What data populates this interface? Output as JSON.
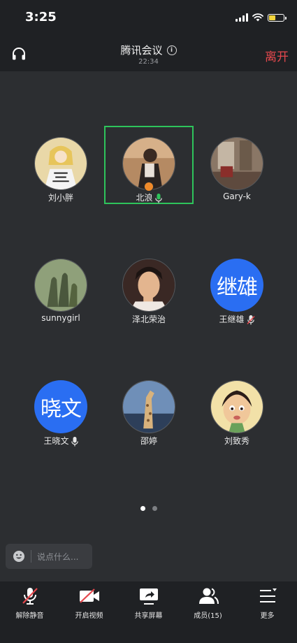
{
  "status_bar": {
    "time": "3:25"
  },
  "header": {
    "title": "腾讯会议",
    "duration": "22:34",
    "leave_label": "离开"
  },
  "participants": [
    {
      "name": "刘小胖",
      "avatar": "photo-girl-sailor"
    },
    {
      "name": "北浪",
      "avatar": "photo-man-coat",
      "speaking": true,
      "mic": "on",
      "host": true
    },
    {
      "name": "Gary-k",
      "avatar": "photo-room"
    },
    {
      "name": "sunnygirl",
      "avatar": "photo-shadows"
    },
    {
      "name": "泽北荣治",
      "avatar": "photo-man-thinking"
    },
    {
      "name": "王继雄",
      "avatar_text": "继雄",
      "mic": "muted"
    },
    {
      "name": "王晓文",
      "avatar_text": "晓文",
      "mic": "on"
    },
    {
      "name": "邵婷",
      "avatar": "photo-giraffe"
    },
    {
      "name": "刘致秀",
      "avatar": "photo-cartoon-girl"
    }
  ],
  "pagination": {
    "pages": 2,
    "current": 1
  },
  "chat": {
    "placeholder": "说点什么..."
  },
  "toolbar": {
    "unmute_label": "解除静音",
    "video_label": "开启视频",
    "share_label": "共享屏幕",
    "members_label": "成员(15)",
    "more_label": "更多"
  },
  "colors": {
    "background": "#2c2e31",
    "bar": "#1f2124",
    "accent_blue": "#2a6ef2",
    "speaking_green": "#2ec45b",
    "leave_red": "#e5484d"
  }
}
